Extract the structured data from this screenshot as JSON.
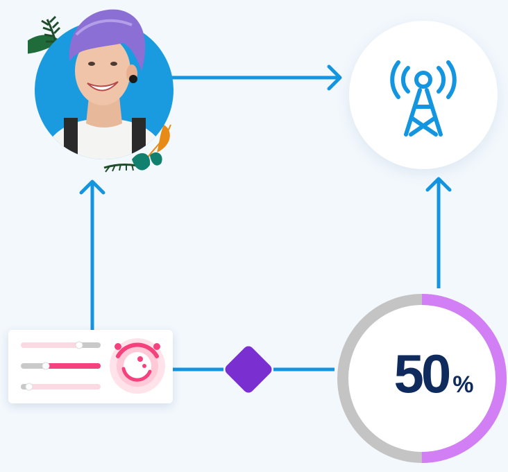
{
  "diagram": {
    "nodes": {
      "person": {
        "icon": "person-photo-avatar"
      },
      "tower": {
        "icon": "radio-tower-icon"
      },
      "controls": {
        "icon": "slider-controls-icon"
      },
      "junction": {
        "icon": "diamond-junction"
      },
      "gauge": {
        "value": 50,
        "value_label": "50",
        "unit_label": "%",
        "fraction": 0.5
      }
    },
    "edges": [
      {
        "from": "controls",
        "to": "person",
        "arrow": true
      },
      {
        "from": "person",
        "to": "tower",
        "arrow": true
      },
      {
        "from": "controls",
        "to": "junction",
        "arrow": false
      },
      {
        "from": "junction",
        "to": "gauge",
        "arrow": false
      },
      {
        "from": "gauge",
        "to": "tower",
        "arrow": true
      }
    ]
  },
  "colors": {
    "background": "#f3f8fd",
    "connector": "#1495e0",
    "avatar_bg": "#1a9be0",
    "tower_icon": "#1495e0",
    "diamond": "#7a2fd0",
    "gauge_track": "#c4c4c4",
    "gauge_fill": "#d27ef5",
    "gauge_text": "#0f2a5c",
    "slider_pink": "#f5417e",
    "slider_track": "#c9c9c9"
  }
}
